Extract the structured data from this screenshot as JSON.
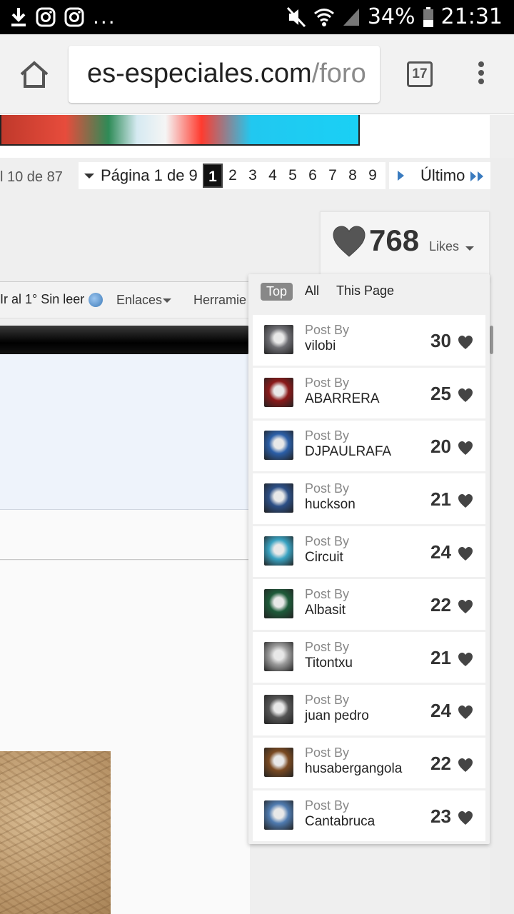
{
  "status_bar": {
    "battery": "34%",
    "time": "21:31",
    "overflow": "..."
  },
  "browser": {
    "url_domain": "es-especiales.com",
    "url_path": "/foro",
    "tab_count": "17"
  },
  "pager": {
    "count_text": "l 10 de 87",
    "page_label": "Página 1 de 9",
    "pages": [
      "1",
      "2",
      "3",
      "4",
      "5",
      "6",
      "7",
      "8",
      "9"
    ],
    "current_page": "1",
    "last_label": "Último"
  },
  "likes": {
    "total": "768",
    "label": "Likes"
  },
  "toolbar": {
    "unread": "Ir al 1° Sin leer",
    "links": "Enlaces",
    "tools": "Herramie"
  },
  "popup": {
    "tabs": [
      "Top",
      "All",
      "This Page"
    ],
    "active_tab": "Top",
    "items": [
      {
        "label": "Post By",
        "user": "vilobi",
        "count": "30",
        "avatar_color": "#6d6d72"
      },
      {
        "label": "Post By",
        "user": "ABARRERA",
        "count": "25",
        "avatar_color": "#8b1a1a"
      },
      {
        "label": "Post By",
        "user": "DJPAULRAFA",
        "count": "20",
        "avatar_color": "#2b5fa8"
      },
      {
        "label": "Post By",
        "user": "huckson",
        "count": "21",
        "avatar_color": "#2c4f86"
      },
      {
        "label": "Post By",
        "user": "Circuit",
        "count": "24",
        "avatar_color": "#3aa3c2"
      },
      {
        "label": "Post By",
        "user": "Albasit",
        "count": "22",
        "avatar_color": "#1e5b3a"
      },
      {
        "label": "Post By",
        "user": "Titontxu",
        "count": "21",
        "avatar_color": "#9a9a9a"
      },
      {
        "label": "Post By",
        "user": "juan pedro",
        "count": "24",
        "avatar_color": "#555555"
      },
      {
        "label": "Post By",
        "user": "husabergangola",
        "count": "22",
        "avatar_color": "#7a4a22"
      },
      {
        "label": "Post By",
        "user": "Cantabruca",
        "count": "23",
        "avatar_color": "#4f7bb0"
      }
    ]
  }
}
